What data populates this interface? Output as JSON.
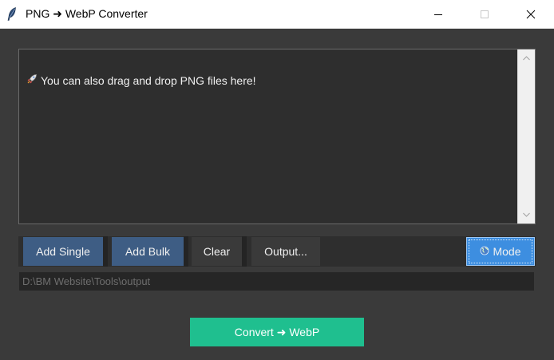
{
  "window": {
    "title": "PNG ➜ WebP Converter",
    "icon": "feather-icon",
    "controls": [
      "minimize-icon",
      "maximize-icon",
      "close-icon"
    ]
  },
  "log": {
    "lines": [
      {
        "icon": "rocket-icon",
        "text": "You can also drag and drop PNG files here!"
      }
    ]
  },
  "toolbar": {
    "add_single": "Add Single",
    "add_bulk": "Add Bulk",
    "clear": "Clear",
    "output": "Output...",
    "mode": "Mode",
    "mode_icon": "globe-icon"
  },
  "output_path": {
    "value": "D:\\BM Website\\Tools\\output"
  },
  "convert": {
    "label": "Convert ➜ WebP"
  },
  "colors": {
    "background": "#3a3a3a",
    "panel": "#2e2e2e",
    "button_blue": "#3e5d84",
    "mode_button": "#3d8ee0",
    "convert_button": "#1fbf8f"
  }
}
